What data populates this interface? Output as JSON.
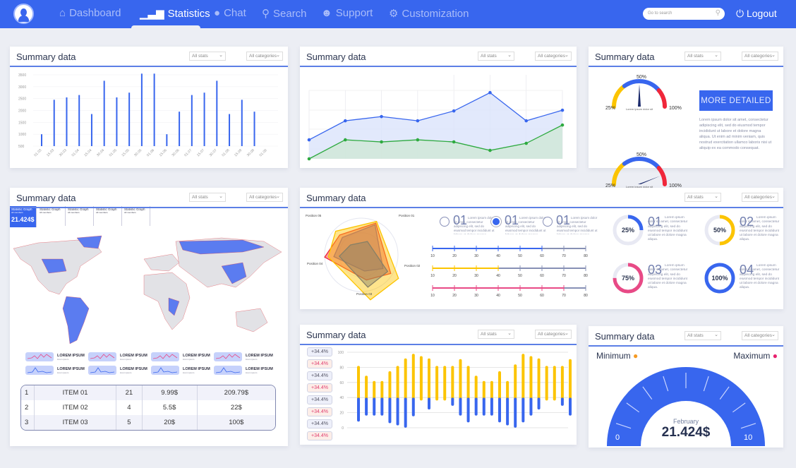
{
  "nav": {
    "items": [
      {
        "label": "Dashboard",
        "icon": "home-icon"
      },
      {
        "label": "Statistics",
        "icon": "bar-chart-icon",
        "active": true
      },
      {
        "label": "Chat",
        "icon": "chat-bubble-icon"
      },
      {
        "label": "Search",
        "icon": "search-icon"
      },
      {
        "label": "Support",
        "icon": "support-icon"
      },
      {
        "label": "Customization",
        "icon": "gear-icon"
      }
    ],
    "search_placeholder": "Go to search",
    "logout": "Logout"
  },
  "colors": {
    "primary": "#3866ee",
    "yellow": "#fcc400",
    "red": "#f0273a",
    "pink": "#e84a86",
    "green": "#2eaa40"
  },
  "panel": {
    "title": "Summary data",
    "stats": "All stats",
    "categories": "All categories"
  },
  "chart_data": [
    {
      "type": "bar",
      "categories": [
        "01.03",
        "15.03",
        "30.03",
        "01.04",
        "15.04",
        "30.04",
        "01.05",
        "15.05",
        "30.05",
        "01.06",
        "15.06",
        "30.06",
        "01.07",
        "15.07",
        "30.07",
        "01.08",
        "15.08",
        "30.08",
        "01.09"
      ],
      "values": [
        1000,
        2450,
        2550,
        2650,
        1850,
        3250,
        2550,
        2750,
        3550,
        3550,
        1000,
        1950,
        2650,
        2750,
        3250,
        1850,
        2450,
        1950,
        null
      ],
      "yticks": [
        500,
        1000,
        1500,
        2000,
        2500,
        3000,
        3500
      ],
      "ylim": [
        500,
        3500
      ],
      "grid": true
    },
    {
      "type": "area",
      "series": [
        {
          "values": [
            27,
            54,
            60,
            54,
            68,
            94,
            54,
            69
          ],
          "color": "#3866ee"
        },
        {
          "values": [
            0,
            27,
            24,
            27,
            24,
            12,
            22,
            48
          ],
          "color": "#2eaa40"
        }
      ],
      "ylim": [
        0,
        100
      ],
      "grid": true
    },
    {
      "type": "stacked-bar",
      "yticks": [
        0,
        20,
        40,
        60,
        80,
        100
      ],
      "ylim": [
        0,
        100
      ],
      "split": 38,
      "top": [
        80,
        67,
        60,
        60,
        73,
        80,
        90,
        96,
        93,
        90,
        80,
        80,
        80,
        89,
        80,
        67,
        60,
        60,
        73,
        60,
        82,
        96,
        93,
        90,
        80,
        80,
        80,
        89
      ],
      "bottom": [
        10,
        18,
        18,
        18,
        8,
        5,
        2,
        17,
        38,
        26,
        38,
        38,
        31,
        18,
        9,
        18,
        18,
        18,
        9,
        5,
        2,
        9,
        18,
        26,
        38,
        38,
        31,
        18
      ]
    },
    {
      "type": "radar",
      "axes": [
        "Position 01",
        "Position 02",
        "Position 03",
        "Position 04",
        "Position 05"
      ],
      "series": [
        {
          "color": "#3866ee",
          "values": [
            0.9,
            0.7,
            0.45,
            0.75,
            0.7
          ]
        },
        {
          "color": "#f0273a",
          "values": [
            0.95,
            0.95,
            0.7,
            1.0,
            0.8
          ]
        },
        {
          "color": "#fcc400",
          "values": [
            1.0,
            1.2,
            1.25,
            0.9,
            0.95
          ]
        },
        {
          "color": "#888066",
          "values": [
            0.4,
            0.85,
            0.9,
            0.6,
            0.4
          ]
        }
      ]
    }
  ],
  "gauges": {
    "labels": [
      "25%",
      "50%",
      "100%"
    ],
    "caption": "Lorem ipsum dolor sit",
    "values": [
      50,
      88
    ]
  },
  "more_button": "MORE DETAILED",
  "lorem": "Lorem ipsum dolor sit amet, consectetur adipiscing elit, sed do eiusmod tempor incididunt ut labore et dolore magna aliqua. Ut enim ad minim veniam, quis nostrud exercitation ullamco laboris nisi ut aliquip ex ea commodo consequat.",
  "lorem_short": "Lorem ipsum dolor sit amet, consectetur adipiscing elit, sed do eiusmod tempor incididunt ut labore et dolore magna aliqua.",
  "stat_graphs": [
    {
      "label": "Statistic Graph",
      "sub": "All members",
      "value": "21.424$"
    },
    {
      "label": "Statistic Graph",
      "sub": "All members"
    },
    {
      "label": "Statistic Graph",
      "sub": "All members"
    },
    {
      "label": "Statistic Graph",
      "sub": "All members"
    },
    {
      "label": "Statistic Graph",
      "sub": "All members"
    }
  ],
  "sparks": {
    "label": "LOREM IPSUM",
    "sub": "lorem ipsum"
  },
  "table": [
    [
      "1",
      "ITEM 01",
      "21",
      "9.99$",
      "209.79$"
    ],
    [
      "2",
      "ITEM 02",
      "4",
      "5.5$",
      "22$"
    ],
    [
      "3",
      "ITEM 03",
      "5",
      "20$",
      "100$"
    ]
  ],
  "options": [
    {
      "num": "01",
      "checked": false
    },
    {
      "num": "01",
      "checked": true
    },
    {
      "num": "01",
      "checked": false
    }
  ],
  "sliders": {
    "ticks": [
      10,
      20,
      30,
      40,
      50,
      60,
      70,
      80
    ],
    "values": [
      60,
      40,
      70
    ],
    "colors": [
      "#3866ee",
      "#fcc400",
      "#e84a86"
    ]
  },
  "donuts": [
    {
      "num": "01",
      "pct": 25,
      "label": "25%",
      "color": "#3866ee"
    },
    {
      "num": "02",
      "pct": 50,
      "label": "50%",
      "color": "#fcc400"
    },
    {
      "num": "03",
      "pct": 75,
      "label": "75%",
      "color": "#e84a86"
    },
    {
      "num": "04",
      "pct": 100,
      "label": "100%",
      "color": "#3866ee"
    }
  ],
  "percent_badges": [
    "+34.4%",
    "+34.4%",
    "+34.4%",
    "+34.4%",
    "+34.4%",
    "+34.4%",
    "+34.4%",
    "+34.4%"
  ],
  "big_gauge": {
    "min_label": "Minimum",
    "max_label": "Maximum",
    "month": "February",
    "value": "21.424$",
    "min": "0",
    "max": "10"
  }
}
